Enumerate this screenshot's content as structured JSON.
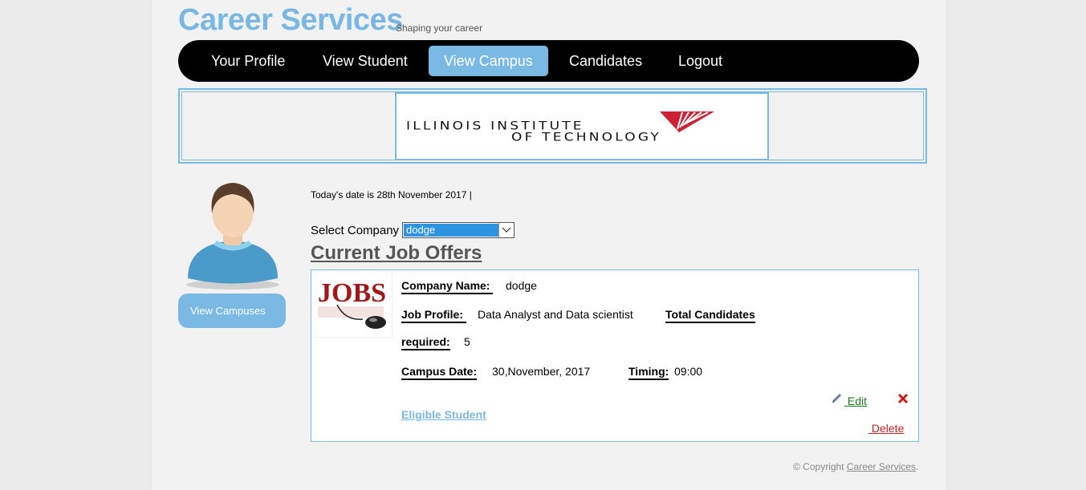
{
  "header": {
    "title": "Career Services",
    "tagline": "Shaping your career"
  },
  "nav": {
    "items": [
      {
        "label": "Your Profile"
      },
      {
        "label": "View Student"
      },
      {
        "label": "View Campus",
        "active": true
      },
      {
        "label": "Candidates"
      },
      {
        "label": "Logout"
      }
    ]
  },
  "banner": {
    "logo_line1": "ILLINOIS INSTITUTE",
    "logo_line2": "OF TECHNOLOGY",
    "logo_colors": {
      "text": "#111111",
      "mark": "#cc2233"
    }
  },
  "sidebar": {
    "avatar_icon": "user-avatar-icon",
    "button_label": "View Campuses"
  },
  "main": {
    "date_text": "Today's date is 28th November 2017  |",
    "select_label": "Select Company",
    "select_value": "dodge",
    "section_title": "Current Job Offers"
  },
  "offer": {
    "image_text": "JOBS",
    "company_label": "Company Name: ",
    "company_value": "dodge",
    "profile_label": "Job Profile: ",
    "profile_value": "Data Analyst and Data scientist",
    "total_label": "Total Candidates",
    "required_label": "required:",
    "required_value": "5",
    "date_label": "Campus Date:",
    "date_value": "30,November, 2017",
    "timing_label": "Timing:",
    "timing_value": "09:00",
    "eligible_label": "Eligible Student",
    "edit_label": " Edit",
    "delete_label": " Delete"
  },
  "footer": {
    "prefix": "© Copyright ",
    "link": "Career Services",
    "suffix": "."
  },
  "colors": {
    "accent": "#7ab9e3",
    "navbar": "#000000",
    "edit": "#1a7a1a",
    "delete": "#cc2222"
  }
}
